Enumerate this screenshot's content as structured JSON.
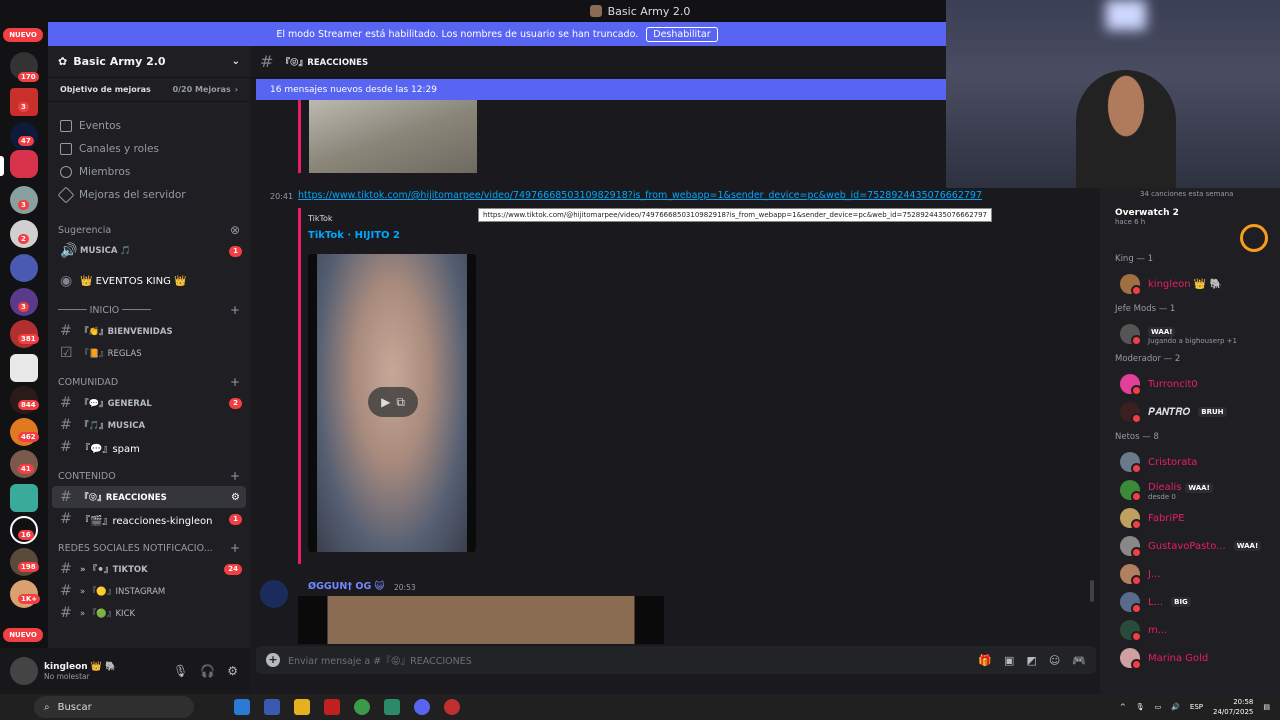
{
  "window_title": "Basic Army 2.0",
  "streamer_banner": {
    "text": "El modo Streamer está habilitado. Los nombres de usuario se han truncado.",
    "button": "Deshabilitar"
  },
  "guild": {
    "name": "Basic Army 2.0",
    "boost_label": "Objetivo de mejoras",
    "boost_progress": "0/20 Mejoras",
    "nav": [
      "Eventos",
      "Canales y roles",
      "Miembros",
      "Mejoras del servidor"
    ],
    "suggestion_label": "Sugerencia",
    "suggestion_channel": "MUSICA 🎵",
    "suggestion_count": "1",
    "events_channel": "👑 EVENTOS KING 👑"
  },
  "categories": {
    "inicio": "───── INICIO ─────",
    "comunidad": "COMUNIDAD",
    "contenido": "CONTENIDO",
    "redes": "REDES SOCIALES NOTIFICACIO..."
  },
  "channels": [
    {
      "name": "『👏』BIENVENIDAS",
      "count": ""
    },
    {
      "name": "『📙』REGLAS",
      "count": ""
    },
    {
      "name": "『💬』GENERAL",
      "count": "2"
    },
    {
      "name": "『🎵』MUSICA",
      "count": ""
    },
    {
      "name": "『💬』spam",
      "count": ""
    },
    {
      "name": "『😝』REACCIONES",
      "count": ""
    },
    {
      "name": "『🎬』reacciones-kingleon",
      "count": "1"
    },
    {
      "name": "» 『⚫』TIKTOK",
      "count": "24"
    },
    {
      "name": "» 『🟡』INSTAGRAM",
      "count": ""
    },
    {
      "name": "» 『🟢』KICK",
      "count": ""
    }
  ],
  "user_panel": {
    "name": "kingleon 👑 🐘",
    "status": "No molestar"
  },
  "chat": {
    "channel_title": "『😝』REACCIONES",
    "new_messages": "16 mensajes nuevos desde las 12:29",
    "message_time": "20:41",
    "link": "https://www.tiktok.com/@hijitomarpee/video/7497666850310982918?is_from_webapp=1&sender_device=pc&web_id=7528924435076662797",
    "tooltip": "https://www.tiktok.com/@hijitomarpee/video/7497666850310982918?is_from_webapp=1&sender_device=pc&web_id=7528924435076662797",
    "embed_provider": "TikTok",
    "embed_title": "TikTok · HIJITO 2",
    "msg2_author": "ØGGUN† OG 😺",
    "msg2_time": "20:53",
    "composer_placeholder": "Enviar mensaje a #『😝』REACCIONES"
  },
  "members": {
    "spotify_note": "34 canciones esta semana",
    "ow_title": "Overwatch 2",
    "ow_sub": "hace 6 h",
    "groups": [
      {
        "title": "King — 1",
        "items": [
          {
            "name": "kingleon 👑 🐘",
            "sub": "",
            "tag": ""
          }
        ]
      },
      {
        "title": "Jefe Mods — 1",
        "items": [
          {
            "name": "",
            "sub": "Jugando a bighouserp +1",
            "tag": "WAA!"
          }
        ]
      },
      {
        "title": "Moderador — 2",
        "items": [
          {
            "name": "Turroncit0",
            "sub": "",
            "tag": ""
          },
          {
            "name": "𝑷𝑨𝑵𝑻𝑹𝑶",
            "sub": "",
            "tag": "BRUH"
          }
        ]
      },
      {
        "title": "Netos — 8",
        "items": [
          {
            "name": "Cristorata",
            "sub": "",
            "tag": ""
          },
          {
            "name": "Diealis",
            "sub": "desde 0",
            "tag": "WAA!"
          },
          {
            "name": "FabriPE",
            "sub": "",
            "tag": ""
          },
          {
            "name": "GustavoPasto...",
            "sub": "",
            "tag": "WAA!"
          },
          {
            "name": "J...",
            "sub": "",
            "tag": ""
          },
          {
            "name": "L...",
            "sub": "",
            "tag": "BIG"
          },
          {
            "name": "m...",
            "sub": "",
            "tag": ""
          },
          {
            "name": "Marina Gold",
            "sub": "",
            "tag": ""
          }
        ]
      }
    ]
  },
  "servers": {
    "nuevo": "NUEVO",
    "badges": [
      "170",
      "3",
      "47",
      "3",
      "2",
      "3",
      "381",
      "844",
      "462",
      "41",
      "16",
      "198",
      "1K+"
    ]
  },
  "taskbar": {
    "search": "Buscar",
    "lang": "ESP",
    "time": "20:58",
    "date": "24/07/2025"
  },
  "colors": {
    "accent": "#5865f2",
    "mention": "#f23f43",
    "link": "#00a8fc",
    "embed_bar": "#e91e63"
  }
}
